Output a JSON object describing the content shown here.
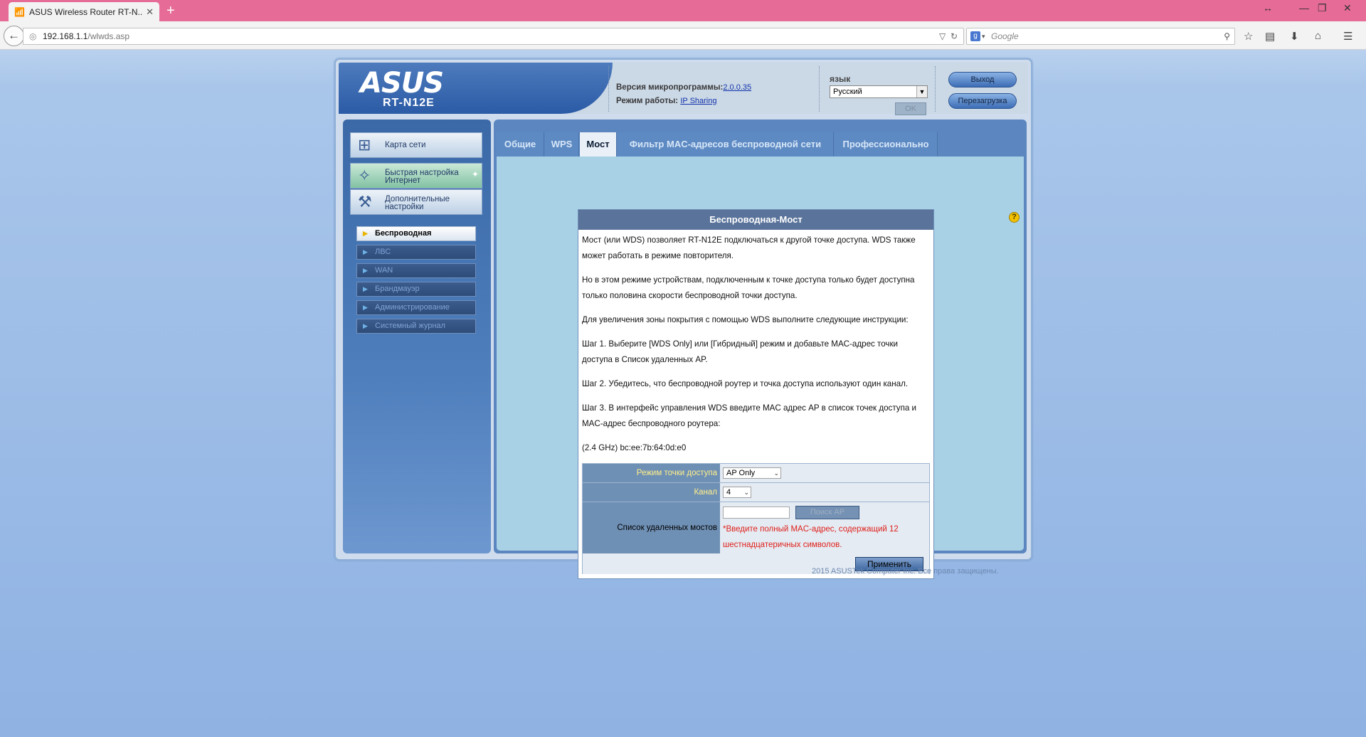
{
  "browser": {
    "tab_title": "ASUS Wireless Router RT-N...",
    "tab_close": "✕",
    "new_tab": "+",
    "url_host": "192.168.1.1",
    "url_path": "/wlwds.asp",
    "search_placeholder": "Google",
    "window_controls": [
      "↔",
      "—",
      "❐",
      "✕"
    ]
  },
  "header": {
    "logo": "ASUS",
    "model": "RT-N12E",
    "firmware_label": "Версия микропрограммы:",
    "firmware_value": "2.0.0.35",
    "mode_label": "Режим работы:",
    "mode_value": "IP Sharing",
    "lang_label": "язык",
    "lang_value": "Русский",
    "ok_label": "OK",
    "logout_label": "Выход",
    "reboot_label": "Перезагрузка"
  },
  "sidebar": {
    "main_items": [
      {
        "label": "Карта сети",
        "icon": "network-map-icon"
      },
      {
        "label": "Быстрая настройка Интернет",
        "icon": "magic-wand-icon"
      },
      {
        "label": "Дополнительные настройки",
        "icon": "tools-icon"
      }
    ],
    "sub_items": [
      {
        "label": "Беспроводная"
      },
      {
        "label": "ЛВС"
      },
      {
        "label": "WAN"
      },
      {
        "label": "Брандмауэр"
      },
      {
        "label": "Администрирование"
      },
      {
        "label": "Системный журнал"
      }
    ]
  },
  "tabs": [
    {
      "label": "Общие"
    },
    {
      "label": "WPS"
    },
    {
      "label": "Мост"
    },
    {
      "label": "Фильтр MAC-адресов беспроводной сети"
    },
    {
      "label": "Профессионально"
    }
  ],
  "panel": {
    "title": "Беспроводная-Мост",
    "paragraphs": [
      "Мост (или WDS) позволяет RT-N12E подключаться к другой точке доступа. WDS также может работать в режиме повторителя.",
      "Но в этом режиме устройствам, подключенным к точке доступа только будет доступна только половина скорости беспроводной точки доступа.",
      "Для увеличения зоны покрытия с помощью WDS выполните следующие инструкции:",
      "Шаг 1. Выберите [WDS Only] или [Гибридный] режим и добавьте MAC-адрес точки доступа в Список удаленных AP.",
      "Шаг 2. Убедитесь, что беспроводной роутер и точка доступа используют один канал.",
      "Шаг 3. В интерфейс управления WDS введите MAC адрес AP в список точек доступа и MAC-адрес беспроводного роутера:",
      "(2.4 GHz) bc:ee:7b:64:0d:e0"
    ],
    "form": {
      "ap_mode_label": "Режим точки доступа",
      "ap_mode_value": "AP Only",
      "channel_label": "Канал",
      "channel_value": "4",
      "remote_label": "Список удаленных мостов",
      "search_ap_label": "Поиск AP",
      "error_text": "*Введите полный MAC-адрес, содержащий 12 шестнадцатеричных символов.",
      "apply_label": "Применить"
    }
  },
  "footer": "2015 ASUSTek Computer Inc. Все права защищены."
}
